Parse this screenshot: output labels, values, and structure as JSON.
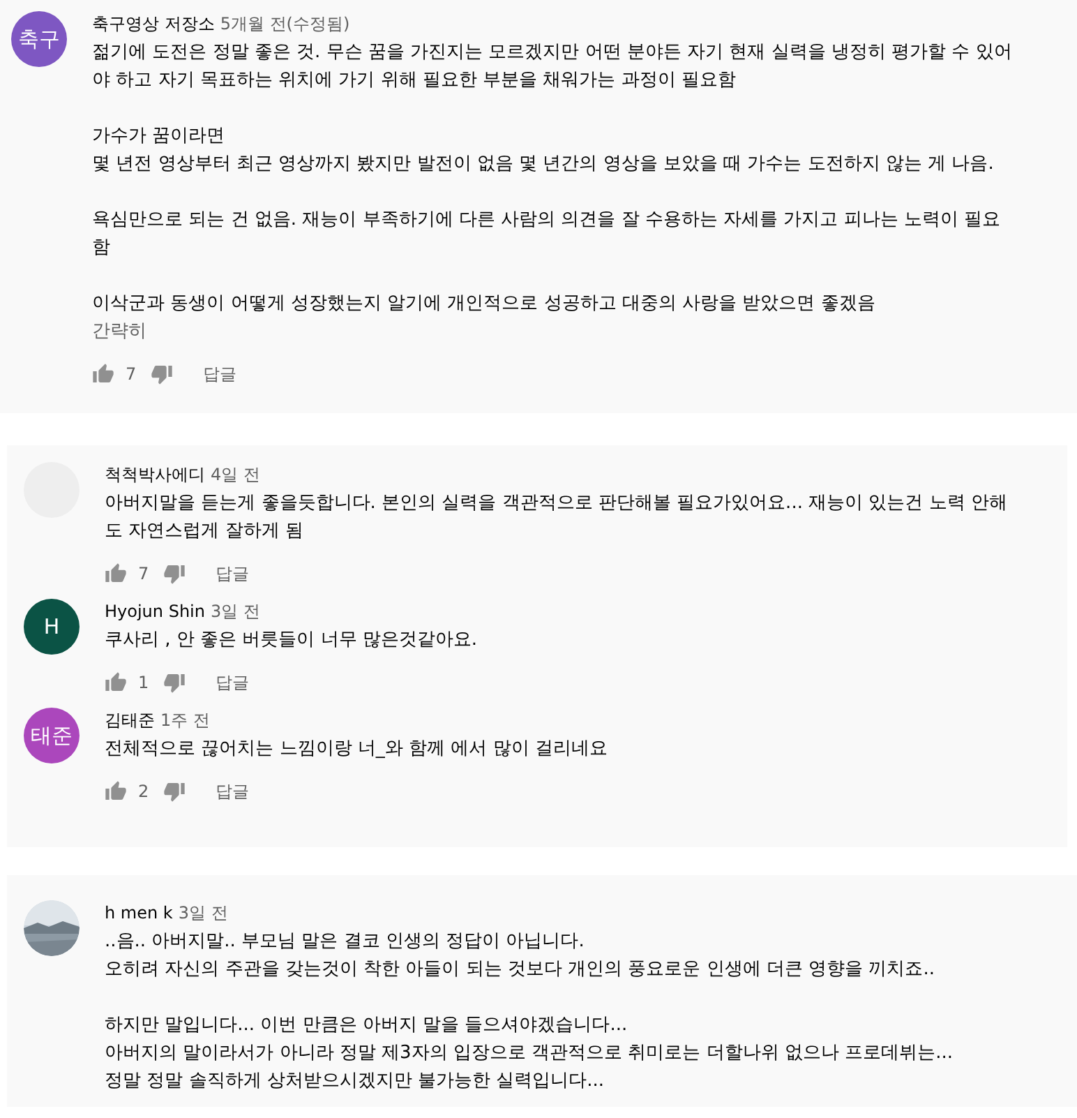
{
  "cards": [
    {
      "comments": [
        {
          "avatar": {
            "kind": "initials",
            "text": "축구",
            "color": "#7e57c2"
          },
          "author": "축구영상 저장소",
          "time": "5개월 전(수정됨)",
          "paragraphs": [
            [
              "젊기에 도전은 정말 좋은 것. 무슨 꿈을 가진지는 모르겠지만 어떤 분야든 자기 현재 실력을 냉정히 평가할 수 있어",
              "야 하고 자기 목표하는 위치에 가기 위해 필요한 부분을 채워가는 과정이 필요함"
            ],
            [
              "가수가 꿈이라면",
              "몇 년전 영상부터 최근 영상까지 봤지만 발전이 없음 몇 년간의  영상을 보았을 때 가수는 도전하지 않는 게 나음."
            ],
            [
              "욕심만으로 되는 건 없음.  재능이 부족하기에 다른 사람의 의견을 잘 수용하는 자세를 가지고 피나는 노력이 필요",
              "함"
            ],
            [
              "이삭군과 동생이 어떻게 성장했는지 알기에 개인적으로 성공하고 대중의 사랑을 받았으면 좋겠음"
            ]
          ],
          "show_less": "간략히",
          "likes": "7",
          "reply": "답글"
        }
      ]
    },
    {
      "comments": [
        {
          "avatar": {
            "kind": "blank"
          },
          "author": "척척박사에디",
          "time": "4일 전",
          "paragraphs": [
            [
              "아버지말을 듣는게 좋을듯합니다. 본인의 실력을 객관적으로 판단해볼 필요가있어요... 재능이 있는건 노력 안해",
              "도 자연스럽게 잘하게 됨"
            ]
          ],
          "likes": "7",
          "reply": "답글"
        },
        {
          "avatar": {
            "kind": "initials",
            "text": "H",
            "color": "#0b5345"
          },
          "author": "Hyojun Shin",
          "time": "3일 전",
          "paragraphs": [
            [
              "쿠사리 , 안 좋은 버릇들이 너무 많은것같아요."
            ]
          ],
          "likes": "1",
          "reply": "답글"
        },
        {
          "avatar": {
            "kind": "initials",
            "text": "태준",
            "color": "#ab47bc"
          },
          "author": "김태준",
          "time": "1주 전",
          "paragraphs": [
            [
              "전체적으로 끊어치는 느낌이랑 너_와 함께 에서 많이 걸리네요"
            ]
          ],
          "likes": "2",
          "reply": "답글"
        }
      ]
    },
    {
      "comments": [
        {
          "avatar": {
            "kind": "picture"
          },
          "author": "h men k",
          "time": "3일 전",
          "paragraphs": [
            [
              "..음.. 아버지말.. 부모님 말은 결코 인생의 정답이 아닙니다.",
              "오히려 자신의 주관을 갖는것이 착한 아들이 되는 것보다 개인의 풍요로운 인생에 더큰 영향을 끼치죠.."
            ],
            [
              "하지만 말입니다... 이번 만큼은 아버지 말을 들으셔야겠습니다...",
              "아버지의 말이라서가 아니라 정말 제3자의 입장으로 객관적으로 취미로는 더할나위 없으나 프로데뷔는...",
              "정말 정말 솔직하게 상처받으시겠지만 불가능한 실력입니다..."
            ]
          ]
        }
      ]
    }
  ]
}
